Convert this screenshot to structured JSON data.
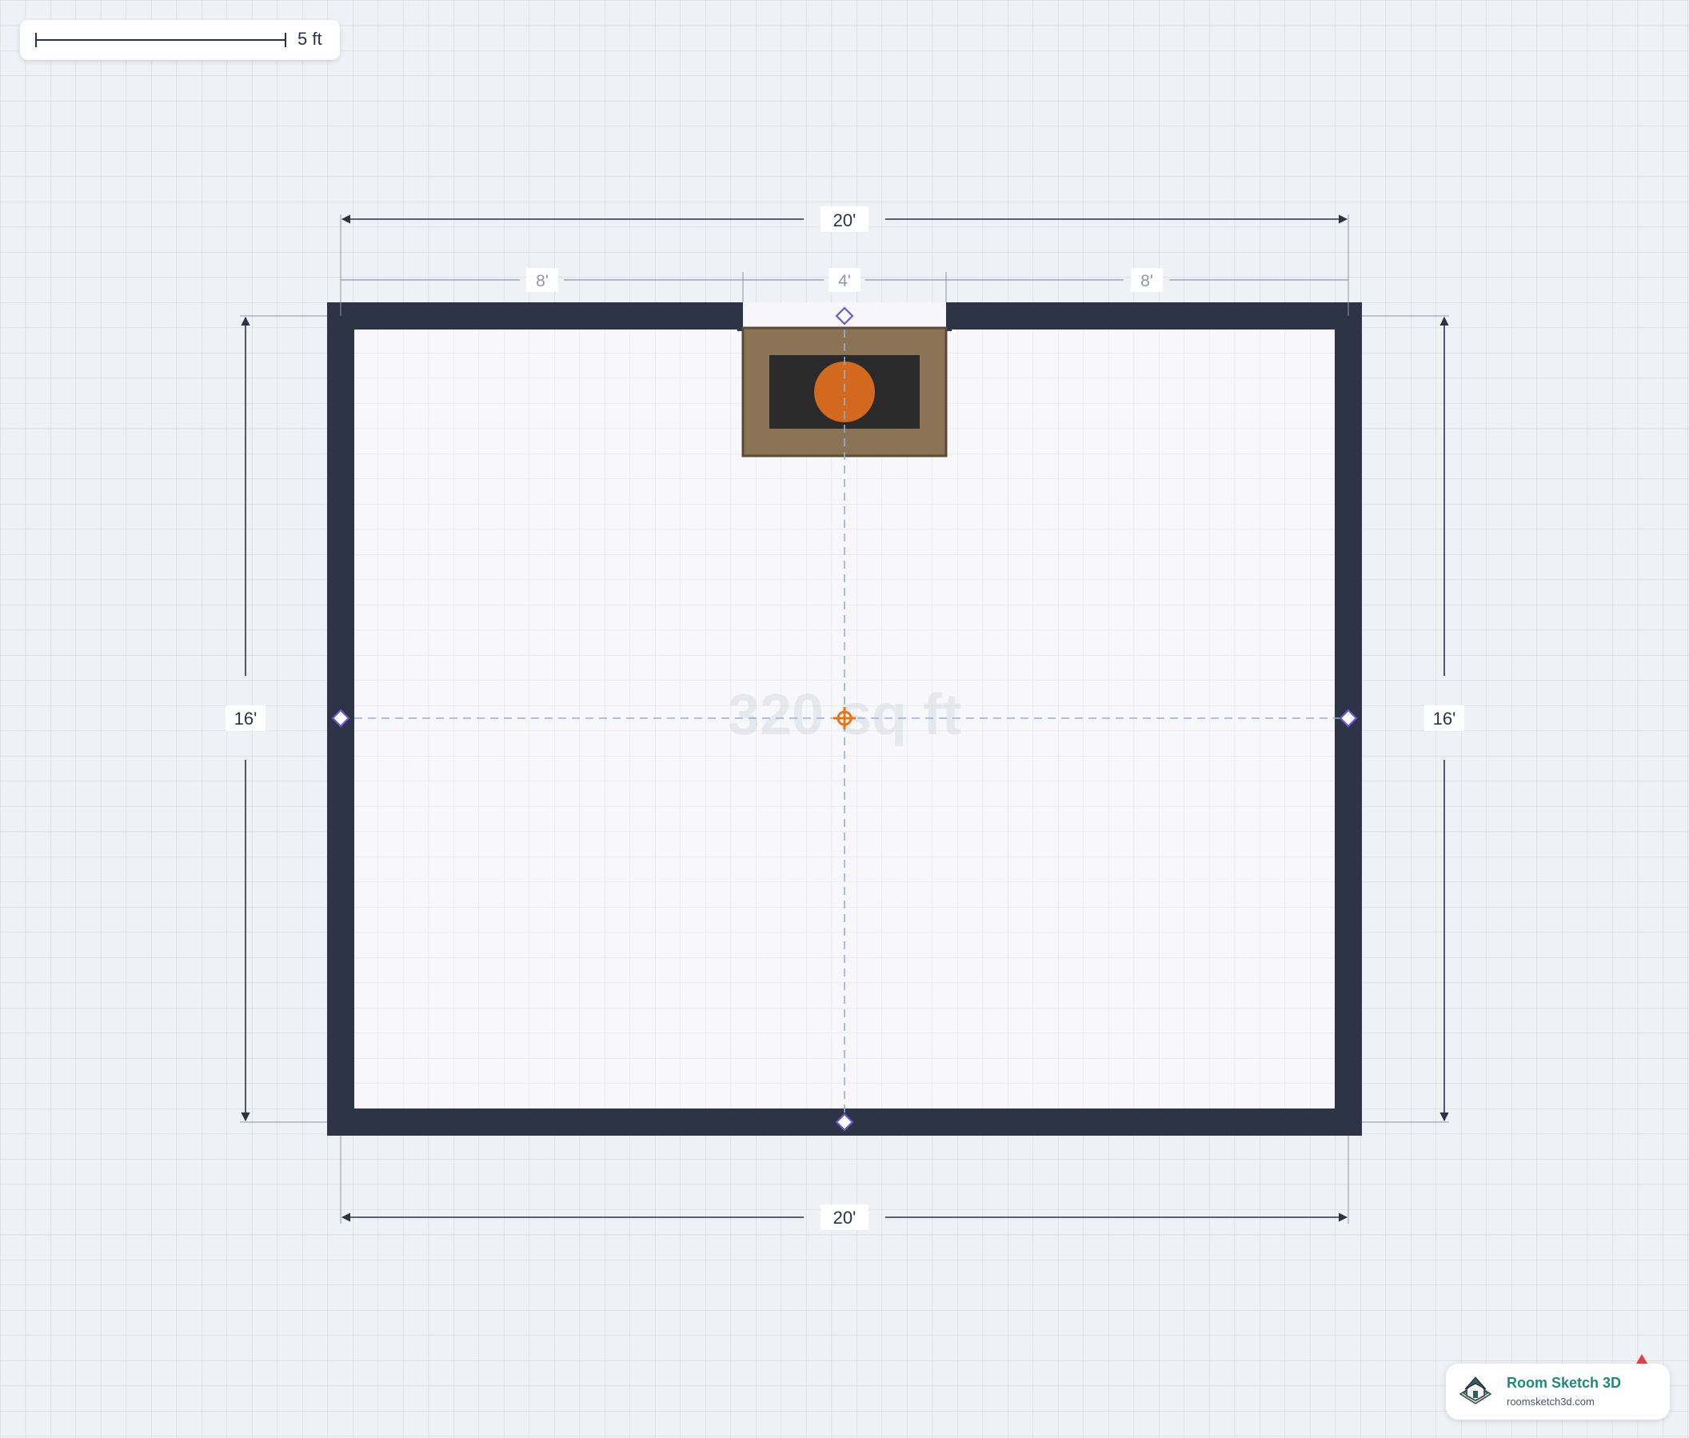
{
  "scale_bar": {
    "label": "5 ft"
  },
  "room": {
    "area_label": "320 sq ft",
    "dimensions": {
      "top_total": "20'",
      "bottom_total": "20'",
      "left_total": "16'",
      "right_total": "16'",
      "top_segment_left": "8'",
      "top_segment_middle": "4'",
      "top_segment_right": "8'"
    }
  },
  "branding": {
    "name": "Room Sketch 3D",
    "url": "roomsketch3d.com"
  },
  "colors": {
    "wall": "#2d3446",
    "floor": "#f8f8fa",
    "canvas_background": "#eef1f5",
    "grid_line": "#d4d9e1",
    "dimension_line": "#2b3342",
    "secondary_dimension": "#8d97a8",
    "guide_line": "#8fb0de",
    "handle": "#6a5acd",
    "center_handle": "#e8741a",
    "fireplace_surround": "#8b7355",
    "firebox": "#2a2a2a",
    "fire": "#d2691e",
    "brand_text": "#1d8a7a"
  },
  "icons": {
    "wall_handle": "diamond-handle-icon",
    "center_handle": "crosshair-handle-icon",
    "logo": "house-logo-icon"
  }
}
